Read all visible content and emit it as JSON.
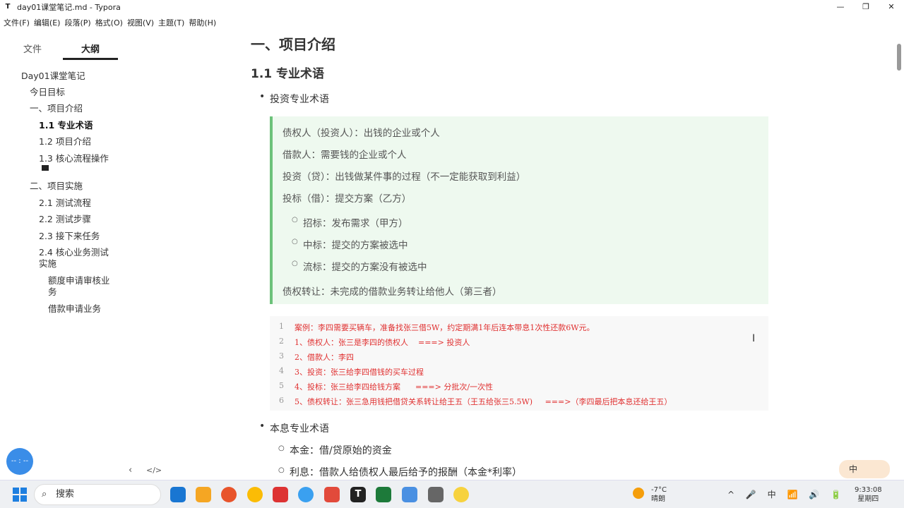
{
  "window": {
    "app_icon": "T",
    "title": "day01课堂笔记.md - Typora",
    "controls": [
      "—",
      "❐",
      "✕"
    ]
  },
  "menu": [
    "文件(F)",
    "编辑(E)",
    "段落(P)",
    "格式(O)",
    "视图(V)",
    "主题(T)",
    "帮助(H)"
  ],
  "sidebar": {
    "tab_files": "文件",
    "tab_outline": "大纲",
    "outline": [
      {
        "label": "Day01课堂笔记",
        "level": 0
      },
      {
        "label": "今日目标",
        "level": 1
      },
      {
        "label": "一、项目介绍",
        "level": 1
      },
      {
        "label": "1.1 专业术语",
        "level": 2,
        "active": true
      },
      {
        "label": "1.2 项目介绍",
        "level": 2
      },
      {
        "label": "1.3 核心流程操作",
        "level": 2
      },
      {
        "label": "二、项目实施",
        "level": 1
      },
      {
        "label": "2.1 测试流程",
        "level": 2
      },
      {
        "label": "2.2 测试步骤",
        "level": 2
      },
      {
        "label": "2.3 接下来任务",
        "level": 2
      },
      {
        "label": "2.4 核心业务测试实施",
        "level": 2
      },
      {
        "label": "额度申请审核业务",
        "level": 3
      },
      {
        "label": "借款申请业务",
        "level": 3
      }
    ],
    "footer_back": "‹",
    "footer_source": "</>",
    "float_label": "-- : --"
  },
  "doc": {
    "h1": "一、项目介绍",
    "h2": "1.1 专业术语",
    "bullet_invest": "投资专业术语",
    "quote_lines": [
      "债权人（投资人）：出钱的企业或个人",
      "借款人：需要钱的企业或个人",
      "投资（贷）：出钱做某件事的过程（不一定能获取到利益）",
      "投标（借）：提交方案（乙方）"
    ],
    "quote_subs": [
      "招标：发布需求（甲方）",
      "中标：提交的方案被选中",
      "流标：提交的方案没有被选中"
    ],
    "quote_last": "债权转让：未完成的借款业务转让给他人（第三者）",
    "code_lines": [
      {
        "n": "1",
        "text": "案例：李四需要买辆车，准备找张三借5W，约定期满1年后连本带息1次性还款6W元。"
      },
      {
        "n": "2",
        "text": "1、债权人：张三是李四的债权人    ===> 投资人"
      },
      {
        "n": "3",
        "text": "2、借款人：李四"
      },
      {
        "n": "4",
        "text": "3、投资：张三给李四借钱的买车过程"
      },
      {
        "n": "5",
        "text": "4、投标：张三给李四给钱方案      ===> 分批次/一次性"
      },
      {
        "n": "6",
        "text": "5、债权转让：张三急用钱把借贷关系转让给王五（王五给张三5.5W)     ===>（李四最后把本息还给王五）"
      }
    ],
    "bullet_interest": "本息专业术语",
    "sub_principal": "本金：借/贷原始的资金",
    "sub_interest": "利息：借款人给债权人最后给予的报酬（本金*利率）"
  },
  "ime": "中",
  "taskbar": {
    "search_placeholder": "搜索",
    "weather_temp": "-7°C",
    "weather_desc": "晴朗",
    "time": "9:33:08",
    "weekday": "星期四",
    "tray_icons": [
      "^",
      "🎤",
      "中",
      "📶",
      "🔊",
      "🔋"
    ],
    "app_colors": [
      "#1976d2",
      "#f5a623",
      "#e8542b",
      "#fbbc05",
      "#d33",
      "#3aa0f0",
      "#e24a3b",
      "#222",
      "#1d7a3a",
      "#4a90e2",
      "#666",
      "#f7d23e"
    ]
  }
}
